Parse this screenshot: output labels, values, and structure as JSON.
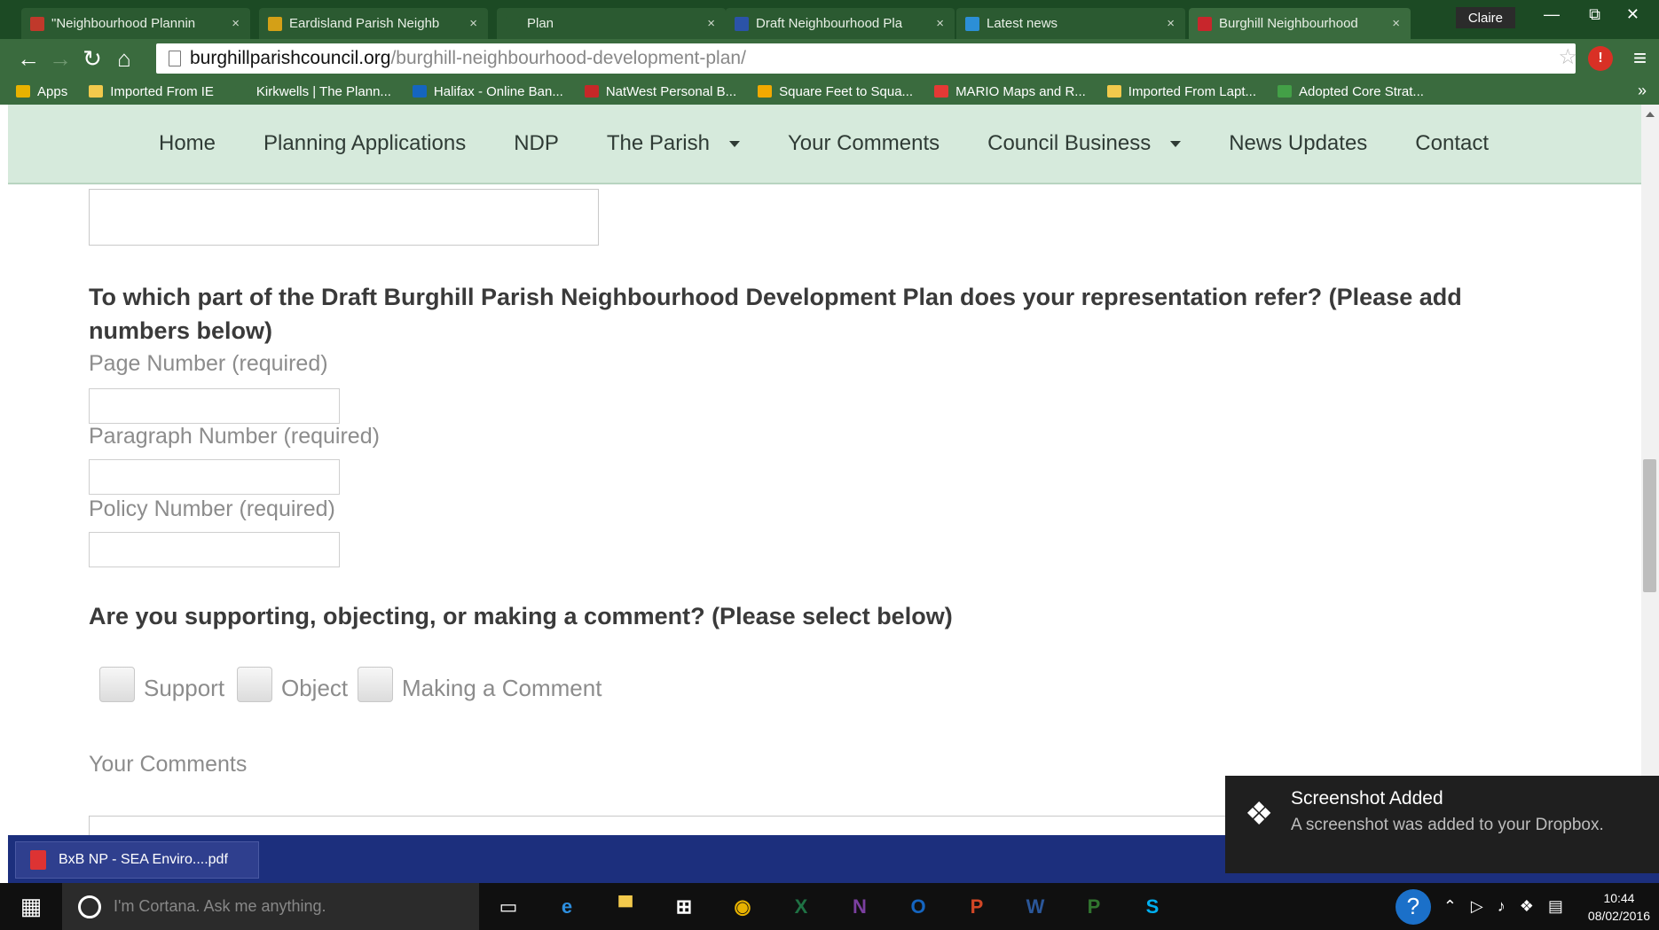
{
  "browser": {
    "tabs": [
      {
        "title": "\"Neighbourhood Plannin",
        "favicon_color": "#c0392b"
      },
      {
        "title": "Eardisland Parish Neighb",
        "favicon_color": "#d4a017"
      },
      {
        "title": "Plan",
        "favicon_color": "#2b5a31"
      },
      {
        "title": "Draft Neighbourhood Pla",
        "favicon_color": "#2b53a8"
      },
      {
        "title": "Latest news",
        "favicon_color": "#2c8fd6"
      },
      {
        "title": "Burghill Neighbourhood",
        "favicon_color": "#c8262c"
      }
    ],
    "close_glyph": "×",
    "profile_name": "Claire",
    "url_host": "burghillparishcouncil.org",
    "url_path": "/burghill-neighbourhood-development-plan/",
    "bookmarks": [
      {
        "label": "Apps",
        "icon_color": "#e8b200"
      },
      {
        "label": "Imported From IE",
        "icon_color": "#f2c94c"
      },
      {
        "label": "Kirkwells | The Plann...",
        "icon_color": "#3a6b3e"
      },
      {
        "label": "Halifax - Online Ban...",
        "icon_color": "#1565c0"
      },
      {
        "label": "NatWest Personal B...",
        "icon_color": "#c62828"
      },
      {
        "label": "Square Feet to Squa...",
        "icon_color": "#f2a900"
      },
      {
        "label": "MARIO Maps and R...",
        "icon_color": "#e53935"
      },
      {
        "label": "Imported From Lapt...",
        "icon_color": "#f2c94c"
      },
      {
        "label": "Adopted Core Strat...",
        "icon_color": "#43a047"
      }
    ],
    "bookmarks_more": "»"
  },
  "site_nav": {
    "items": [
      {
        "label": "Home",
        "dropdown": false
      },
      {
        "label": "Planning Applications",
        "dropdown": false
      },
      {
        "label": "NDP",
        "dropdown": false
      },
      {
        "label": "The Parish",
        "dropdown": true
      },
      {
        "label": "Your Comments",
        "dropdown": false
      },
      {
        "label": "Council Business",
        "dropdown": true
      },
      {
        "label": "News Updates",
        "dropdown": false
      },
      {
        "label": "Contact",
        "dropdown": false
      }
    ]
  },
  "form": {
    "question_part_line1": "To which part of the Draft Burghill Parish Neighbourhood Development Plan does your representation refer? (Please add",
    "question_part_line2": "numbers below)",
    "page_number_label": "Page Number (required)",
    "paragraph_number_label": "Paragraph Number (required)",
    "policy_number_label": "Policy Number (required)",
    "page_number_value": "",
    "paragraph_number_value": "",
    "policy_number_value": "",
    "question_stance": "Are you supporting, objecting, or making a comment? (Please select below)",
    "options": [
      {
        "label": "Support",
        "checked": false
      },
      {
        "label": "Object",
        "checked": false
      },
      {
        "label": "Making a Comment",
        "checked": false
      }
    ],
    "comments_label": "Your Comments"
  },
  "downloads": {
    "file": "BxB NP - SEA Enviro....pdf"
  },
  "toast": {
    "title": "Screenshot Added",
    "message": "A screenshot was added to your Dropbox."
  },
  "taskbar": {
    "search_placeholder": "I'm Cortana. Ask me anything.",
    "apps": [
      {
        "name": "edge",
        "glyph": "e",
        "color": "#2d8fe0"
      },
      {
        "name": "file-explorer",
        "glyph": "▀",
        "color": "#f2c94c"
      },
      {
        "name": "store",
        "glyph": "⊞",
        "color": "#ffffff"
      },
      {
        "name": "chrome",
        "glyph": "◉",
        "color": "#e8b200"
      },
      {
        "name": "excel",
        "glyph": "X",
        "color": "#1f7244"
      },
      {
        "name": "onenote",
        "glyph": "N",
        "color": "#7b3fa0"
      },
      {
        "name": "outlook",
        "glyph": "O",
        "color": "#1565c0"
      },
      {
        "name": "powerpoint",
        "glyph": "P",
        "color": "#d24726"
      },
      {
        "name": "word",
        "glyph": "W",
        "color": "#2b579a"
      },
      {
        "name": "project",
        "glyph": "P",
        "color": "#31752f"
      },
      {
        "name": "skype",
        "glyph": "S",
        "color": "#00aff0"
      }
    ],
    "time": "10:44",
    "date": "08/02/2016"
  }
}
